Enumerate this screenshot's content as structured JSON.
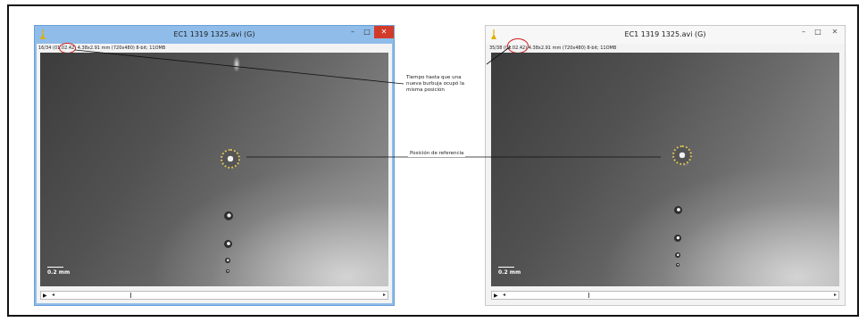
{
  "windows": [
    {
      "title": "EC1 1319 1325.avi (G)",
      "info": "16/34 (01.02.42) 4.38x2.91 mm (720x480) 8-bit; 11OMB",
      "scale_label": "0.2 mm"
    },
    {
      "title": "EC1 1319 1325.avi (G)",
      "info": "35/38 (01.02.42) 4.38x2.91 mm (720x480) 8-bit; 11OMB",
      "scale_label": "0.2 mm"
    }
  ],
  "annotations": {
    "time_note": "Tiempo hasta que una nueva burbuja ocupó la misma posición",
    "reference_note": "Posición de referencia"
  },
  "window_controls": {
    "minimize": "–",
    "maximize": "□",
    "close": "✕"
  },
  "scrollbar": {
    "play": "▶",
    "left": "◂",
    "right": "▸"
  },
  "colors": {
    "annotation_circle": "#d02020",
    "reference_ring": "#d8c060",
    "left_title_bar": "#8fbce9"
  }
}
